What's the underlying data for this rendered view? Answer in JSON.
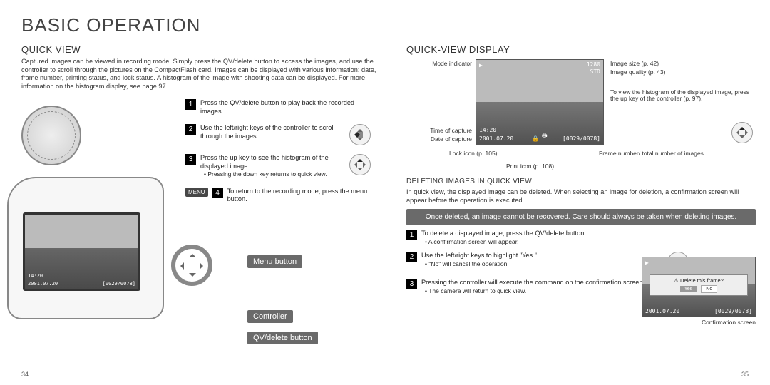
{
  "page": {
    "title": "BASIC OPERATION",
    "left_num": "34",
    "right_num": "35"
  },
  "quickview": {
    "heading": "QUICK VIEW",
    "intro": "Captured images can be viewed in recording mode. Simply press the QV/delete button to access the images, and use the controller to scroll through the pictures on the CompactFlash card. Images can be displayed with various information: date, frame number, printing status, and lock status. A histogram of the image with shooting data can be displayed. For more information on the histogram display, see page 97.",
    "steps": [
      {
        "n": "1",
        "t": "Press the QV/delete button to play back the recorded images."
      },
      {
        "n": "2",
        "t": "Use the left/right keys of the controller to scroll through the images."
      },
      {
        "n": "3",
        "t": "Press the up key to see the histogram of the displayed image.",
        "sub": "Pressing the down key returns to quick view."
      },
      {
        "n": "4",
        "t": "To return to the recording mode, press the menu button."
      }
    ],
    "menu_label": "MENU",
    "callouts": {
      "menu": "Menu button",
      "controller": "Controller",
      "qv": "QV/delete button"
    },
    "lcd": {
      "time": "14:20",
      "date": "2001.07.20",
      "frame": "[0029/0078]"
    }
  },
  "display": {
    "heading": "QUICK-VIEW DISPLAY",
    "labels": {
      "mode": "Mode indicator",
      "size": "Image size (p. 42)",
      "qual": "Image quality (p. 43)",
      "histo": "To view the histogram of the displayed image, press the up key of the controller (p. 97).",
      "time": "Time of capture",
      "date": "Date of capture",
      "lock": "Lock icon (p. 105)",
      "print": "Print icon (p. 108)",
      "frame": "Frame number/ total number of images"
    },
    "overlay": {
      "mode_icon": "▶",
      "size": "1280",
      "qual": "STD",
      "time": "14:20",
      "date": "2001.07.20",
      "frame": "[0029/0078]"
    }
  },
  "delete": {
    "heading": "DELETING IMAGES IN QUICK VIEW",
    "intro": "In quick view, the displayed image can be deleted. When selecting an image for deletion, a confirmation screen will appear before the operation is executed.",
    "warning": "Once deleted, an image cannot be recovered. Care should always be taken when deleting images.",
    "steps": [
      {
        "n": "1",
        "t": "To delete a displayed image, press the QV/delete button.",
        "sub": "A confirmation screen will appear."
      },
      {
        "n": "2",
        "t": "Use the left/right keys to highlight \"Yes.\"",
        "sub": "\"No\" will cancel the operation."
      },
      {
        "n": "3",
        "t": "Pressing the controller will execute the command on the confirmation screen.",
        "sub": "The camera will return to quick view."
      }
    ],
    "confirm": {
      "prompt": "⚠ Delete this frame?",
      "yes": "Yes",
      "no": "No",
      "caption": "Confirmation screen",
      "date": "2001.07.20",
      "frame": "[0029/0078]"
    }
  }
}
